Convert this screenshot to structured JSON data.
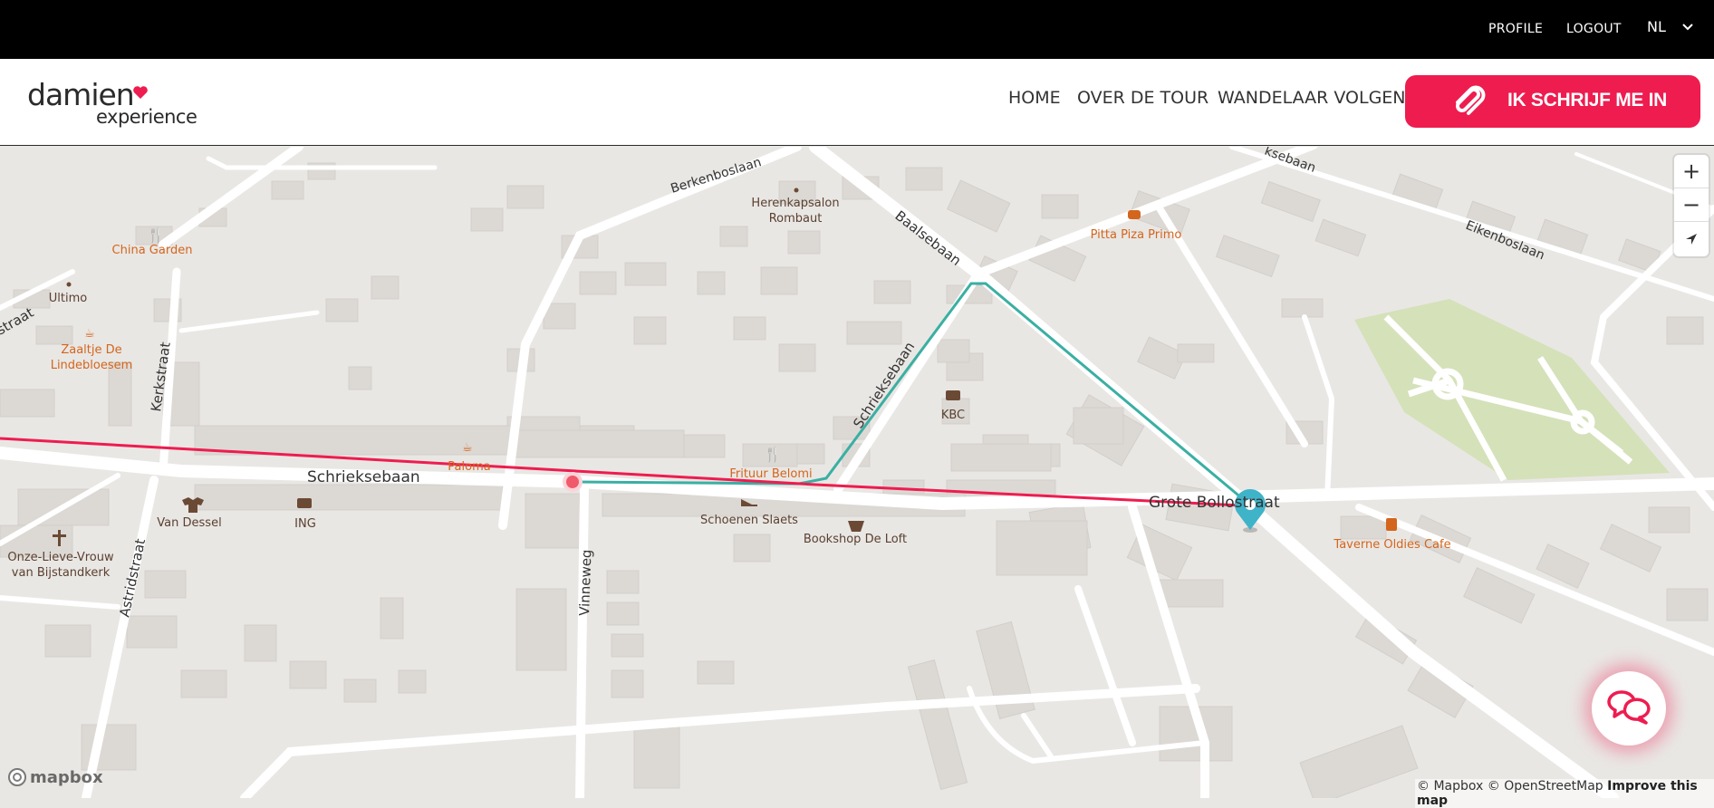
{
  "topbar": {
    "profile": "PROFILE",
    "logout": "LOGOUT",
    "language": "NL"
  },
  "header": {
    "logo_line1": "damien",
    "logo_line2": "experience",
    "nav": [
      "HOME",
      "OVER DE TOUR",
      "WANDELAAR VOLGEN"
    ],
    "cta": "IK SCHRIJF ME IN"
  },
  "map": {
    "streets": [
      "Schrieksebaan",
      "Berkenboslaan",
      "Baalsebaan",
      "Schrieksebaan",
      "Kerkstraat",
      "Astridstraat",
      "Vinneweg",
      "Grote Bollostraat",
      "Eikenboslaan",
      "ksebaan",
      "straat"
    ],
    "pois": [
      "China Garden",
      "Ultimo",
      "Zaaltje De Lindebloesem",
      "Herenkapsalon Rombaut",
      "Pitta Piza Primo",
      "KBC",
      "Paloma",
      "Frituur Belomi",
      "Schoenen Slaets",
      "Bookshop De Loft",
      "Van Dessel",
      "ING",
      "Onze-Lieve-Vrouw van Bijstandkerk",
      "Taverne Oldies Cafe"
    ],
    "zoom_in": "+",
    "zoom_out": "−",
    "attribution": "© Mapbox © OpenStreetMap",
    "improve": "Improve this map",
    "mapbox_logo": "mapbox"
  },
  "colors": {
    "accent": "#ee1c4f",
    "route_green": "#3aafa3",
    "route_red": "#ee1c4f",
    "poi_orange": "#d4651c",
    "marker_blue": "#3fb3c8"
  }
}
